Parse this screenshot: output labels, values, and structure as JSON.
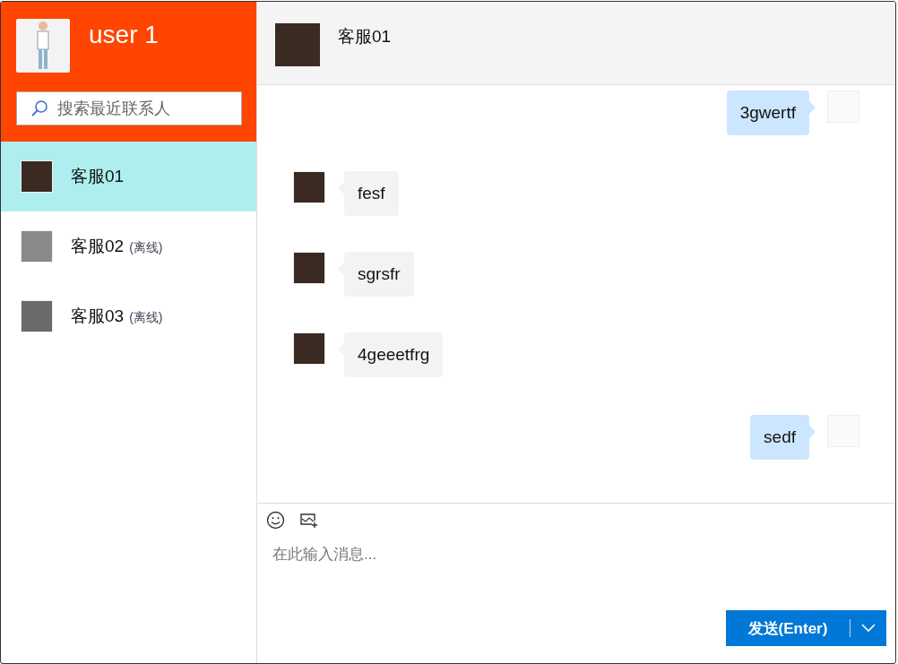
{
  "user": {
    "name": "user 1"
  },
  "search": {
    "placeholder": "搜索最近联系人"
  },
  "contacts": [
    {
      "name": "客服01",
      "selected": true
    },
    {
      "name": "客服02",
      "status": "(离线)",
      "selected": false
    },
    {
      "name": "客服03",
      "status": "(离线)",
      "selected": false
    }
  ],
  "chat": {
    "title": "客服01"
  },
  "messages": [
    {
      "kind": "self",
      "text": "3gwertf"
    },
    {
      "kind": "other",
      "text": "fesf"
    },
    {
      "kind": "other",
      "text": "sgrsfr"
    },
    {
      "kind": "other",
      "text": "4geeetfrg"
    },
    {
      "kind": "self",
      "text": "sedf"
    }
  ],
  "composer": {
    "placeholder": "在此输入消息..."
  },
  "send_button": {
    "label": "发送(Enter)"
  }
}
